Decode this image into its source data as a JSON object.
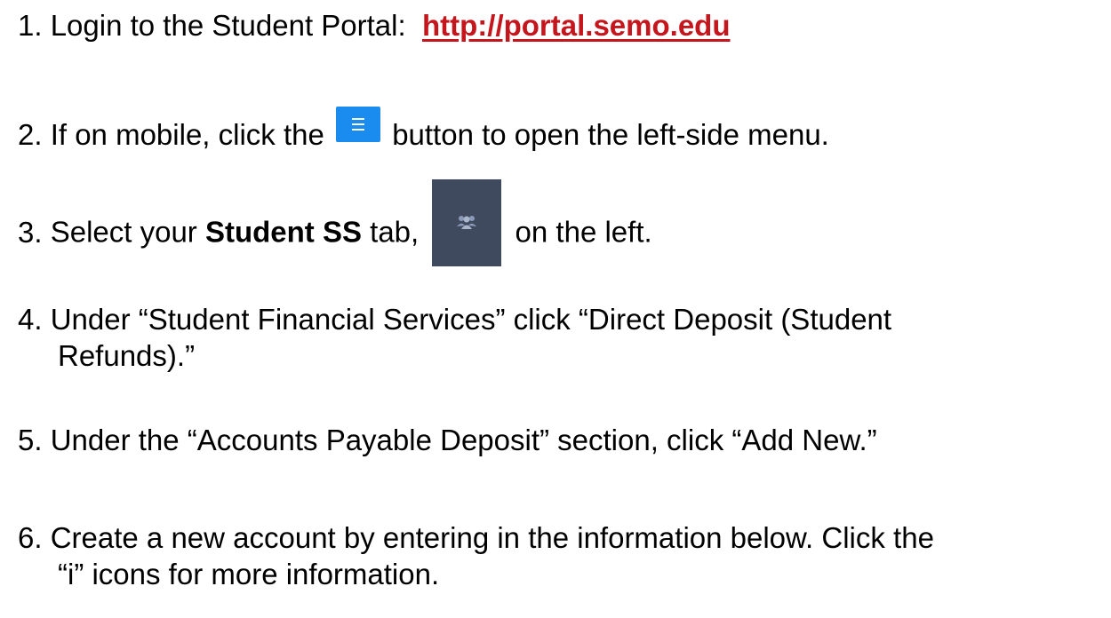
{
  "steps": [
    {
      "num": "1.",
      "text": "Login to the Student Portal:",
      "link": "http://portal.semo.edu"
    },
    {
      "num": "2.",
      "before": "If on mobile, click the",
      "icon": "hamburger-menu-icon",
      "after": "button to open the left-side menu."
    },
    {
      "num": "3.",
      "before": "Select your",
      "bold": "Student SS",
      "middle": "tab,",
      "icon": "users-group-icon",
      "after": "on the left."
    },
    {
      "num": "4.",
      "line1": "Under “Student Financial Services” click “Direct Deposit (Student",
      "line2": "Refunds).”"
    },
    {
      "num": "5.",
      "text": "Under the “Accounts Payable Deposit” section, click “Add New.”"
    },
    {
      "num": "6.",
      "line1": "Create a new account by entering in the information below. Click the",
      "line2": "“i” icons for more information."
    }
  ],
  "colors": {
    "link": "#c4161c",
    "menu_button": "#1a8cf0",
    "tab_tile": "#3f4a5e",
    "tab_icon": "#8a9ab8"
  }
}
